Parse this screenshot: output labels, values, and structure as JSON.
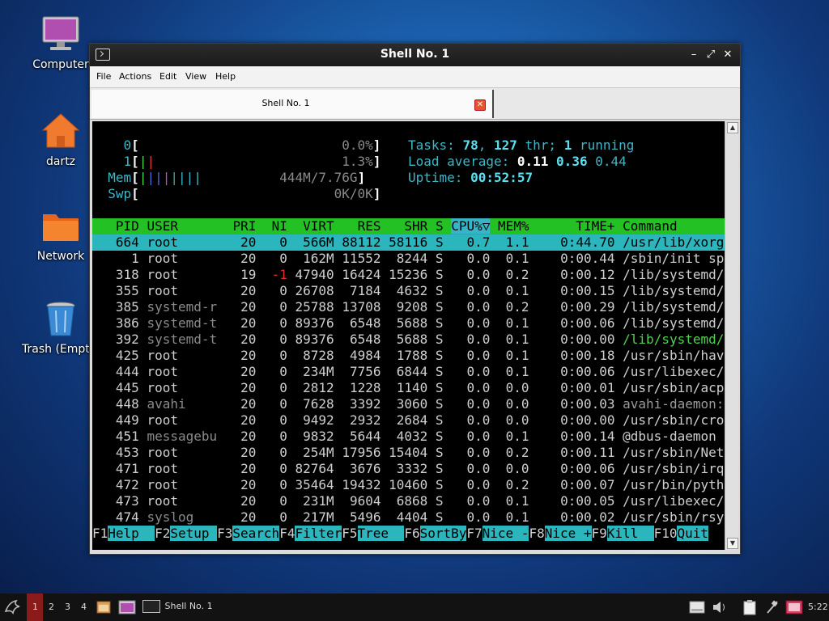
{
  "desktop": {
    "icons": [
      {
        "label": "Computer",
        "icon": "monitor-icon"
      },
      {
        "label": "dartz",
        "icon": "home-folder-icon"
      },
      {
        "label": "Network",
        "icon": "network-folder-icon"
      },
      {
        "label": "Trash (Empty)",
        "icon": "trash-icon"
      }
    ]
  },
  "window": {
    "title": "Shell No. 1",
    "controls": {
      "minimize": "–",
      "maximize": "⤢",
      "close": "✕"
    },
    "menu": [
      "File",
      "Actions",
      "Edit",
      "View",
      "Help"
    ],
    "tab": {
      "label": "Shell No. 1",
      "close": "✕"
    }
  },
  "htop": {
    "cpu0": {
      "label": "0",
      "value": "0.0%"
    },
    "cpu1": {
      "label": "1",
      "value": "1.3%"
    },
    "mem": {
      "label": "Mem",
      "value": "444M/7.76G"
    },
    "swp": {
      "label": "Swp",
      "value": "0K/0K"
    },
    "tasks": {
      "label": "Tasks:",
      "tasks": "78",
      "thr": "127",
      "thr_label": "thr;",
      "running": "1",
      "running_label": "running"
    },
    "load": {
      "label": "Load average:",
      "l1": "0.11",
      "l5": "0.36",
      "l15": "0.44"
    },
    "uptime": {
      "label": "Uptime:",
      "value": "00:52:57"
    },
    "columns": {
      "pid": "PID",
      "user": "USER",
      "pri": "PRI",
      "ni": "NI",
      "virt": "VIRT",
      "res": "RES",
      "shr": "SHR",
      "s": "S",
      "cpu": "CPU%▽",
      "mem": "MEM%",
      "time": "TIME+",
      "cmd": "Command"
    },
    "processes": [
      {
        "pid": "664",
        "user": "root",
        "pri": "20",
        "ni": "0",
        "virt": "566M",
        "res": "88112",
        "shr": "58116",
        "s": "S",
        "cpu": "0.7",
        "mem": "1.1",
        "time": "0:44.70",
        "cmd": "/usr/lib/xorg"
      },
      {
        "pid": "1",
        "user": "root",
        "pri": "20",
        "ni": "0",
        "virt": "162M",
        "res": "11552",
        "shr": "8244",
        "s": "S",
        "cpu": "0.0",
        "mem": "0.1",
        "time": "0:00.44",
        "cmd": "/sbin/init sp"
      },
      {
        "pid": "318",
        "user": "root",
        "pri": "19",
        "ni": "-1",
        "virt": "47940",
        "res": "16424",
        "shr": "15236",
        "s": "S",
        "cpu": "0.0",
        "mem": "0.2",
        "time": "0:00.12",
        "cmd": "/lib/systemd/"
      },
      {
        "pid": "355",
        "user": "root",
        "pri": "20",
        "ni": "0",
        "virt": "26708",
        "res": "7184",
        "shr": "4632",
        "s": "S",
        "cpu": "0.0",
        "mem": "0.1",
        "time": "0:00.15",
        "cmd": "/lib/systemd/"
      },
      {
        "pid": "385",
        "user": "systemd-r",
        "pri": "20",
        "ni": "0",
        "virt": "25788",
        "res": "13708",
        "shr": "9208",
        "s": "S",
        "cpu": "0.0",
        "mem": "0.2",
        "time": "0:00.29",
        "cmd": "/lib/systemd/"
      },
      {
        "pid": "386",
        "user": "systemd-t",
        "pri": "20",
        "ni": "0",
        "virt": "89376",
        "res": "6548",
        "shr": "5688",
        "s": "S",
        "cpu": "0.0",
        "mem": "0.1",
        "time": "0:00.06",
        "cmd": "/lib/systemd/"
      },
      {
        "pid": "392",
        "user": "systemd-t",
        "pri": "20",
        "ni": "0",
        "virt": "89376",
        "res": "6548",
        "shr": "5688",
        "s": "S",
        "cpu": "0.0",
        "mem": "0.1",
        "time": "0:00.00",
        "cmd": "/lib/systemd/"
      },
      {
        "pid": "425",
        "user": "root",
        "pri": "20",
        "ni": "0",
        "virt": "8728",
        "res": "4984",
        "shr": "1788",
        "s": "S",
        "cpu": "0.0",
        "mem": "0.1",
        "time": "0:00.18",
        "cmd": "/usr/sbin/hav"
      },
      {
        "pid": "444",
        "user": "root",
        "pri": "20",
        "ni": "0",
        "virt": "234M",
        "res": "7756",
        "shr": "6844",
        "s": "S",
        "cpu": "0.0",
        "mem": "0.1",
        "time": "0:00.06",
        "cmd": "/usr/libexec/"
      },
      {
        "pid": "445",
        "user": "root",
        "pri": "20",
        "ni": "0",
        "virt": "2812",
        "res": "1228",
        "shr": "1140",
        "s": "S",
        "cpu": "0.0",
        "mem": "0.0",
        "time": "0:00.01",
        "cmd": "/usr/sbin/acp"
      },
      {
        "pid": "448",
        "user": "avahi",
        "pri": "20",
        "ni": "0",
        "virt": "7628",
        "res": "3392",
        "shr": "3060",
        "s": "S",
        "cpu": "0.0",
        "mem": "0.0",
        "time": "0:00.03",
        "cmd": "avahi-daemon:"
      },
      {
        "pid": "449",
        "user": "root",
        "pri": "20",
        "ni": "0",
        "virt": "9492",
        "res": "2932",
        "shr": "2684",
        "s": "S",
        "cpu": "0.0",
        "mem": "0.0",
        "time": "0:00.00",
        "cmd": "/usr/sbin/cro"
      },
      {
        "pid": "451",
        "user": "messagebu",
        "pri": "20",
        "ni": "0",
        "virt": "9832",
        "res": "5644",
        "shr": "4032",
        "s": "S",
        "cpu": "0.0",
        "mem": "0.1",
        "time": "0:00.14",
        "cmd": "@dbus-daemon"
      },
      {
        "pid": "453",
        "user": "root",
        "pri": "20",
        "ni": "0",
        "virt": "254M",
        "res": "17956",
        "shr": "15404",
        "s": "S",
        "cpu": "0.0",
        "mem": "0.2",
        "time": "0:00.11",
        "cmd": "/usr/sbin/Net"
      },
      {
        "pid": "471",
        "user": "root",
        "pri": "20",
        "ni": "0",
        "virt": "82764",
        "res": "3676",
        "shr": "3332",
        "s": "S",
        "cpu": "0.0",
        "mem": "0.0",
        "time": "0:00.06",
        "cmd": "/usr/sbin/irq"
      },
      {
        "pid": "472",
        "user": "root",
        "pri": "20",
        "ni": "0",
        "virt": "35464",
        "res": "19432",
        "shr": "10460",
        "s": "S",
        "cpu": "0.0",
        "mem": "0.2",
        "time": "0:00.07",
        "cmd": "/usr/bin/pyth"
      },
      {
        "pid": "473",
        "user": "root",
        "pri": "20",
        "ni": "0",
        "virt": "231M",
        "res": "9604",
        "shr": "6868",
        "s": "S",
        "cpu": "0.0",
        "mem": "0.1",
        "time": "0:00.05",
        "cmd": "/usr/libexec/"
      },
      {
        "pid": "474",
        "user": "syslog",
        "pri": "20",
        "ni": "0",
        "virt": "217M",
        "res": "5496",
        "shr": "4404",
        "s": "S",
        "cpu": "0.0",
        "mem": "0.1",
        "time": "0:00.02",
        "cmd": "/usr/sbin/rsy"
      }
    ],
    "fkeys": [
      {
        "key": "F1",
        "label": "Help  "
      },
      {
        "key": "F2",
        "label": "Setup "
      },
      {
        "key": "F3",
        "label": "Search"
      },
      {
        "key": "F4",
        "label": "Filter"
      },
      {
        "key": "F5",
        "label": "Tree  "
      },
      {
        "key": "F6",
        "label": "SortBy"
      },
      {
        "key": "F7",
        "label": "Nice -"
      },
      {
        "key": "F8",
        "label": "Nice +"
      },
      {
        "key": "F9",
        "label": "Kill  "
      },
      {
        "key": "F10",
        "label": "Quit"
      }
    ]
  },
  "taskbar": {
    "workspaces": [
      "1",
      "2",
      "3",
      "4"
    ],
    "active_workspace": "1",
    "task": "Shell No. 1",
    "clock": "5:22"
  },
  "colors": {
    "header_green": "#23c123",
    "selection_cyan": "#2bb6be",
    "desktop_blue": "#1b62b0"
  }
}
